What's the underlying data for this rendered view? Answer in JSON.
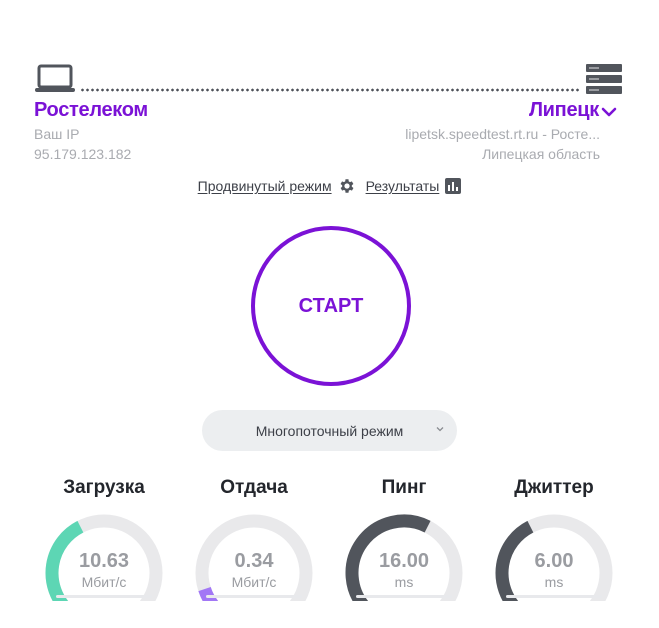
{
  "isp": {
    "name": "Ростелеком",
    "ip_label": "Ваш IP",
    "ip_value": "95.179.123.182"
  },
  "server": {
    "city": "Липецк",
    "host": "lipetsk.speedtest.rt.ru - Росте...",
    "region": "Липецкая область"
  },
  "links": {
    "advanced": "Продвинутый режим",
    "results": "Результаты"
  },
  "start_label": "СТАРТ",
  "mode": {
    "selected": "Многопоточный режим"
  },
  "colors": {
    "accent": "#7b12d6",
    "download": "#5dd6b4",
    "upload": "#a277f5",
    "ping": "#51555c",
    "track": "#e9e9eb"
  },
  "icons": {
    "client": "laptop-icon",
    "server": "server-icon",
    "settings": "gear-icon",
    "results": "bar-chart-icon",
    "dropdown": "chevron-down-icon"
  },
  "gauges": [
    {
      "title": "Загрузка",
      "value": "10.63",
      "unit": "Мбит/с",
      "fill": 0.4,
      "color": "#5dd6b4"
    },
    {
      "title": "Отдача",
      "value": "0.34",
      "unit": "Мбит/с",
      "fill": 0.1,
      "color": "#a277f5"
    },
    {
      "title": "Пинг",
      "value": "16.00",
      "unit": "ms",
      "fill": 0.6,
      "color": "#51555c"
    },
    {
      "title": "Джиттер",
      "value": "6.00",
      "unit": "ms",
      "fill": 0.4,
      "color": "#51555c"
    }
  ]
}
